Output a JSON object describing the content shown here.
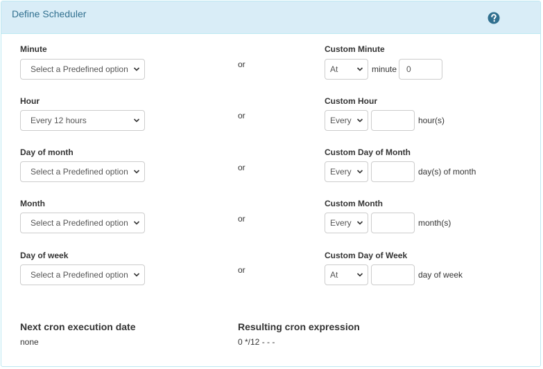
{
  "panel": {
    "title": "Define Scheduler",
    "help_icon": "question-circle-icon"
  },
  "or_label": "or",
  "rows": [
    {
      "label": "Minute",
      "predefined_value": "Select a Predefined option",
      "custom_label": "Custom Minute",
      "custom_mode": "At",
      "custom_value": "0",
      "custom_placeholder": "",
      "inline_label": "minute",
      "suffix": ""
    },
    {
      "label": "Hour",
      "predefined_value": "Every 12 hours",
      "custom_label": "Custom Hour",
      "custom_mode": "Every",
      "custom_value": "",
      "suffix": "hour(s)"
    },
    {
      "label": "Day of month",
      "predefined_value": "Select a Predefined option",
      "custom_label": "Custom Day of Month",
      "custom_mode": "Every",
      "custom_value": "",
      "suffix": "day(s) of month"
    },
    {
      "label": "Month",
      "predefined_value": "Select a Predefined option",
      "custom_label": "Custom Month",
      "custom_mode": "Every",
      "custom_value": "",
      "suffix": "month(s)"
    },
    {
      "label": "Day of week",
      "predefined_value": "Select a Predefined option",
      "custom_label": "Custom Day of Week",
      "custom_mode": "At",
      "custom_value": "",
      "suffix": "day of week"
    }
  ],
  "result": {
    "next_label": "Next cron execution date",
    "next_value": "none",
    "expression_label": "Resulting cron expression",
    "expression_value": "0 */12 - - -"
  },
  "colors": {
    "heading_bg": "#d9edf7",
    "heading_border": "#bce8f1",
    "title_text": "#31708f",
    "help_icon": "#31708f"
  }
}
